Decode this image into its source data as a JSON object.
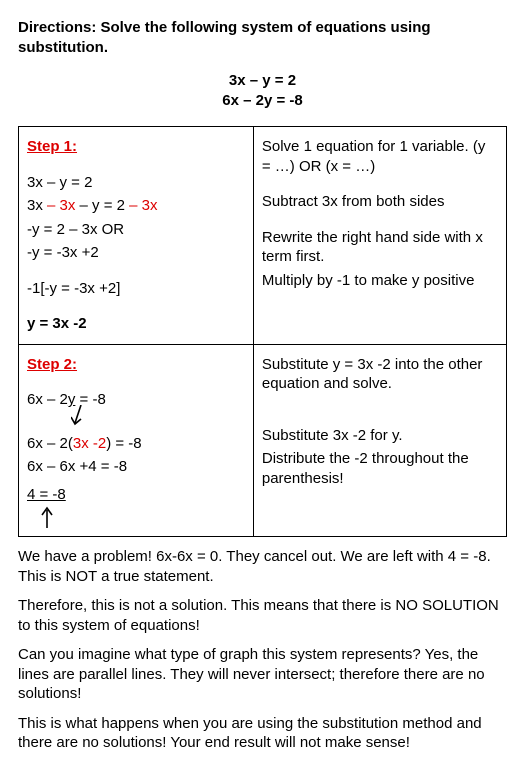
{
  "directions": "Directions:  Solve the following system of equations using substitution.",
  "eq1": "3x – y = 2",
  "eq2": "6x – 2y = -8",
  "step1": {
    "label": "Step 1:",
    "l1": "3x – y = 2",
    "l2a": "3x ",
    "l2b": "– 3x",
    "l2c": " – y = 2 ",
    "l2d": "– 3x",
    "l3": "-y = 2 – 3x   OR",
    "l4": "-y = -3x +2",
    "l5": "-1[-y = -3x +2]",
    "l6": "y = 3x -2",
    "r1": "Solve 1 equation for 1 variable. (y = …) OR (x = …)",
    "r2": "Subtract 3x from both sides",
    "r3": "Rewrite the right hand side with x term first.",
    "r4": "Multiply by -1 to make y positive"
  },
  "step2": {
    "label": "Step 2:",
    "l1a": "6x – 2",
    "l1b": "y",
    "l1c": " = -8",
    "l2a": "6x – 2(",
    "l2b": "3x -2",
    "l2c": ") = -8",
    "l3": "6x – 6x +4 = -8",
    "l4": "4 = -8",
    "r1": "Substitute y = 3x -2 into the other equation and solve.",
    "r2": "Substitute 3x -2 for y.",
    "r3": "Distribute the -2 throughout the parenthesis!"
  },
  "p1": "We have a problem!  6x-6x = 0.  They cancel out.  We are left with 4 = -8.  This is NOT a true statement.",
  "p2": "Therefore, this is not a solution.  This means that there is NO SOLUTION to this system of equations!",
  "p3": "Can you imagine what type of graph this system represents?  Yes, the lines are parallel lines.  They will never intersect; therefore there are no solutions!",
  "p4": "This is what happens when you are using the substitution method and there are no solutions!  Your end result will not make sense!"
}
